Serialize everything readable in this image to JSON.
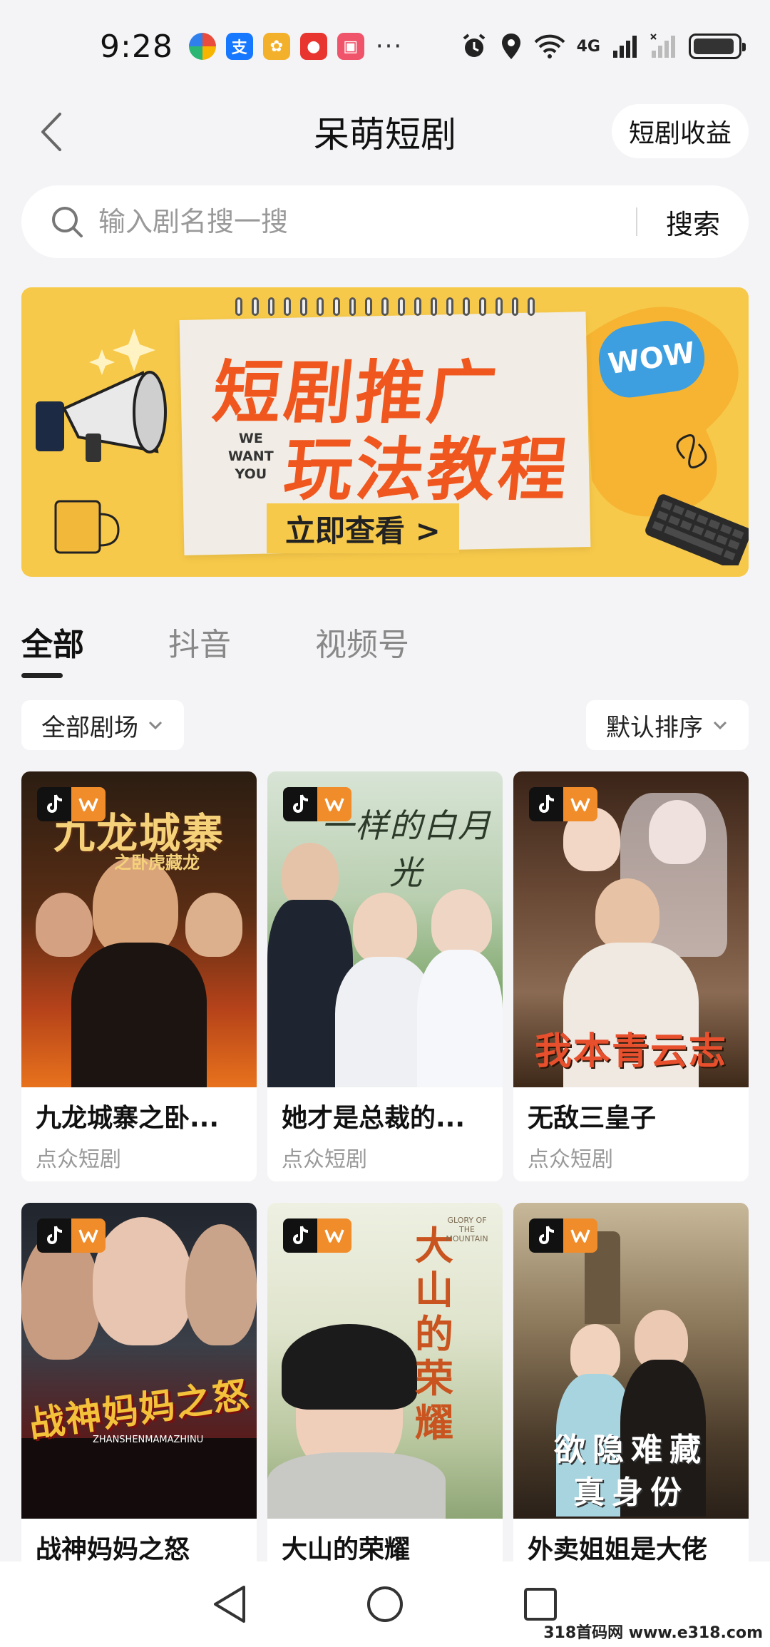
{
  "status_bar": {
    "time": "9:28",
    "more": "···",
    "network": "4G",
    "icons": [
      "alarm-icon",
      "location-icon",
      "wifi-icon",
      "signal-icon",
      "battery-icon"
    ]
  },
  "header": {
    "title": "呆萌短剧",
    "earnings_label": "短剧收益"
  },
  "search": {
    "placeholder": "输入剧名搜一搜",
    "button_label": "搜索"
  },
  "banner": {
    "line1": "短剧推广",
    "line2": "玩法教程",
    "cta": "立即查看 >",
    "side_text": "WE\nWANT\nYOU",
    "wow": "WOW"
  },
  "tabs": [
    {
      "label": "全部",
      "active": true
    },
    {
      "label": "抖音",
      "active": false
    },
    {
      "label": "视频号",
      "active": false
    }
  ],
  "filters": {
    "theater": "全部剧场",
    "sort": "默认排序"
  },
  "dramas": [
    {
      "title": "九龙城寨之卧...",
      "source": "点众短剧",
      "poster_text": "九龙城寨",
      "poster_sub": "之卧虎藏龙"
    },
    {
      "title": "她才是总裁的...",
      "source": "点众短剧",
      "poster_text": "一样的白月光",
      "poster_sub": ""
    },
    {
      "title": "无敌三皇子",
      "source": "点众短剧",
      "poster_text": "我本青云志",
      "poster_sub": ""
    },
    {
      "title": "战神妈妈之怒",
      "source": "",
      "poster_text": "战神妈妈之怒",
      "poster_sub": "ZHANSHENMAMAZHINU"
    },
    {
      "title": "大山的荣耀",
      "source": "",
      "poster_text": "大山的荣耀",
      "poster_sub": "GLORY OF THE MOUNTAIN"
    },
    {
      "title": "外卖姐姐是大佬",
      "source": "",
      "poster_text": "欲隐难藏",
      "poster_sub": "真身份"
    }
  ],
  "watermark": "318首码网 www.e318.com"
}
